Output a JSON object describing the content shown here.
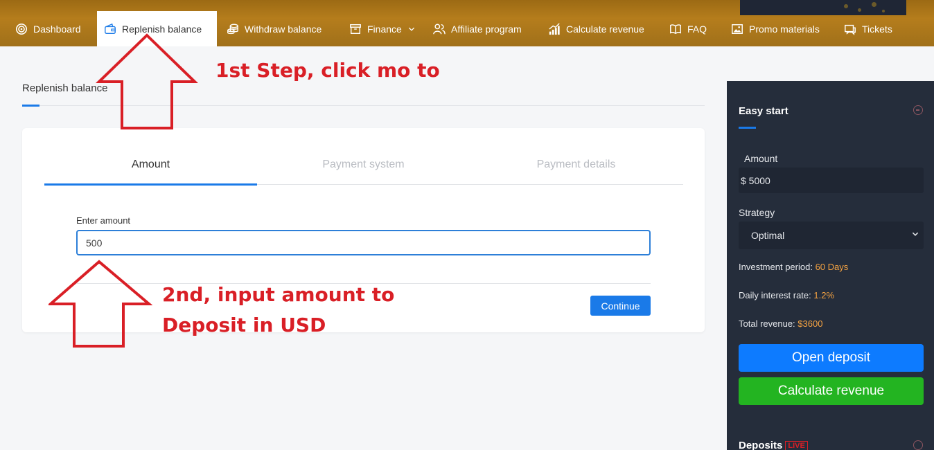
{
  "nav": {
    "items": [
      {
        "label": "Dashboard",
        "icon": "target-icon"
      },
      {
        "label": "Replenish balance",
        "icon": "wallet-icon"
      },
      {
        "label": "Withdraw balance",
        "icon": "coins-icon"
      },
      {
        "label": "Finance",
        "icon": "archive-icon"
      },
      {
        "label": "Affiliate program",
        "icon": "users-icon"
      },
      {
        "label": "Calculate revenue",
        "icon": "chart-icon"
      },
      {
        "label": "FAQ",
        "icon": "book-icon"
      },
      {
        "label": "Promo materials",
        "icon": "image-icon"
      },
      {
        "label": "Tickets",
        "icon": "tickets-icon"
      }
    ],
    "active": "Replenish balance"
  },
  "page": {
    "breadcrumb": "Replenish balance"
  },
  "wizard": {
    "tabs": [
      "Amount",
      "Payment system",
      "Payment details"
    ],
    "active_tab": "Amount",
    "amount_label": "Enter amount",
    "amount_value": "500",
    "continue_label": "Continue"
  },
  "annotations": {
    "step1": "1st Step, click mo to",
    "step2_line1": "2nd, input amount to",
    "step2_line2": "Deposit in USD"
  },
  "sidebar": {
    "title": "Easy start",
    "amount_label": "Amount",
    "amount_value": "$ 5000",
    "strategy_label": "Strategy",
    "strategy_value": "Optimal",
    "period_label": "Investment period:",
    "period_value": "60 Days",
    "rate_label": "Daily interest rate:",
    "rate_value": "1.2%",
    "revenue_label": "Total revenue:",
    "revenue_value": "$3600",
    "open_deposit": "Open deposit",
    "calculate_revenue": "Calculate revenue",
    "deposits_title": "Deposits",
    "live_badge": "LIVE"
  },
  "colors": {
    "accent": "#1a7ae8",
    "nav_bg": "#b57d1c",
    "sidebar_bg": "#252d3b",
    "highlight": "#f5a342",
    "annotation": "#d91f26",
    "green_button": "#23b421"
  }
}
